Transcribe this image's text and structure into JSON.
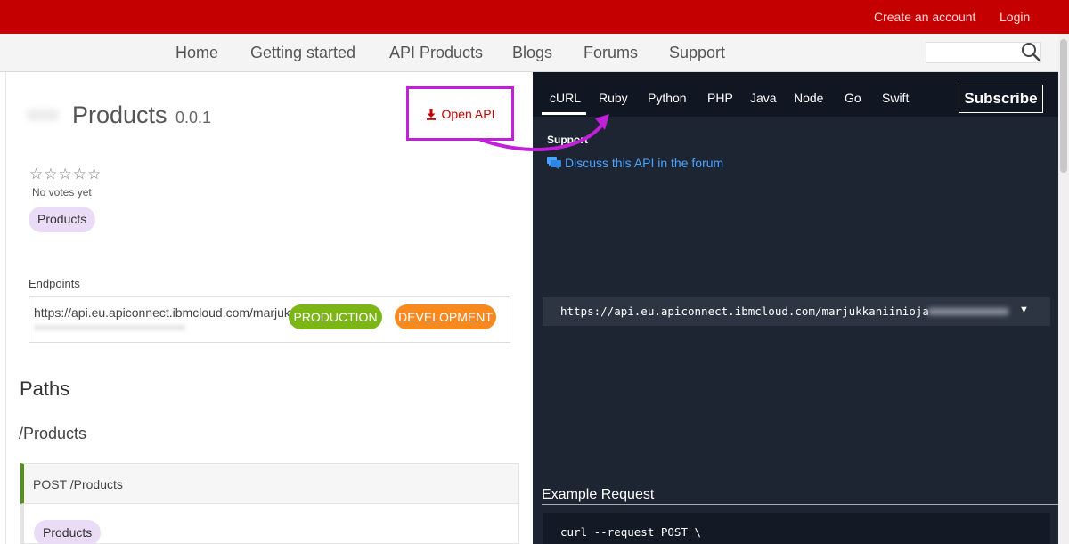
{
  "topbar": {
    "create_account": "Create an account",
    "login": "Login"
  },
  "nav": {
    "items": [
      "Home",
      "Getting started",
      "API Products",
      "Blogs",
      "Forums",
      "Support"
    ],
    "search_placeholder": ""
  },
  "product": {
    "title": "Products",
    "version": "0.0.1",
    "open_api_label": "Open API",
    "rating_text": "No votes yet",
    "tag": "Products"
  },
  "endpoints": {
    "label": "Endpoints",
    "url": "https://api.eu.apiconnect.ibmcloud.com/marjukkaniinioja",
    "production": "PRODUCTION",
    "development": "DEVELOPMENT"
  },
  "paths": {
    "heading": "Paths",
    "path": "/Products",
    "operation": "POST /Products",
    "tag": "Products"
  },
  "code_panel": {
    "tabs": [
      "cURL",
      "Ruby",
      "Python",
      "PHP",
      "Java",
      "Node",
      "Go",
      "Swift"
    ],
    "active_tab": "cURL",
    "subscribe": "Subscribe",
    "support_label": "Support",
    "forum_link": "Discuss this API in the forum",
    "endpoint_select": "https://api.eu.apiconnect.ibmcloud.com/marjukkaniinioja",
    "example_heading": "Example Request",
    "example_code": "curl --request POST \\"
  },
  "colors": {
    "topbar": "#c40000",
    "highlight": "#c020d8",
    "production": "#7cb516",
    "development": "#f7891f",
    "code_bg": "#1d2532",
    "link": "#49a3ff"
  }
}
